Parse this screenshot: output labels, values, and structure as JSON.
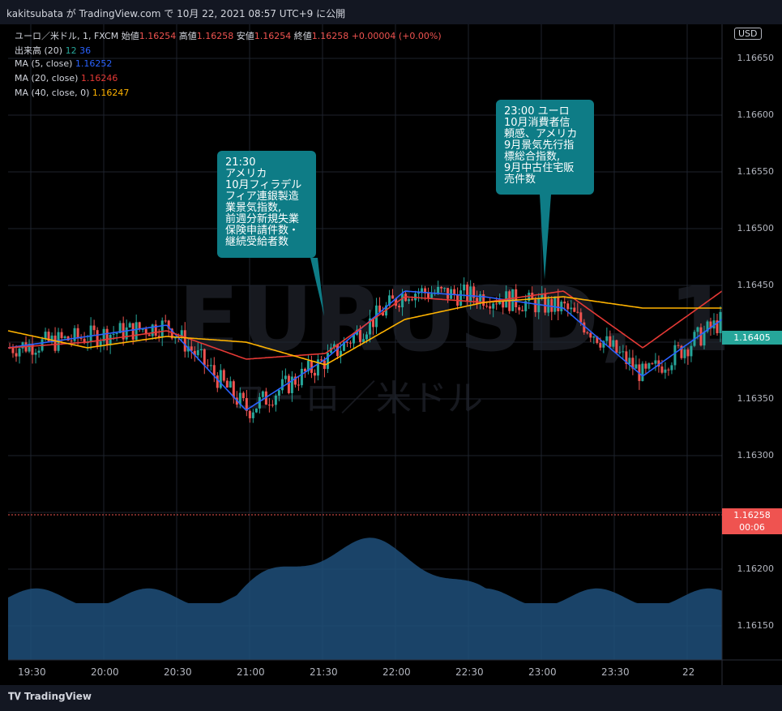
{
  "header": {
    "published_text": "kakitsubata が TradingView.com で 10月 22, 2021 08:57 UTC+9 に公開"
  },
  "legend": {
    "symbol": "ユーロ／米ドル, 1, FXCM",
    "open_label": "始値",
    "open": "1.16254",
    "high_label": "高値",
    "high": "1.16258",
    "low_label": "安値",
    "low": "1.16254",
    "close_label": "終値",
    "close": "1.16258",
    "change": "+0.00004 (+0.00%)",
    "volume_label": "出来高 (20)",
    "volume_val1": "12",
    "volume_val2": "36",
    "ma5_label": "MA (5, close)",
    "ma5_val": "1.16252",
    "ma20_label": "MA (20, close)",
    "ma20_val": "1.16246",
    "ma40_label": "MA (40, close, 0)",
    "ma40_val": "1.16247"
  },
  "watermark": {
    "ticker": "EURUSD, 1",
    "name": "ユーロ／米ドル"
  },
  "currency": "USD",
  "price_axis_labels": [
    "1.16650",
    "1.16600",
    "1.16550",
    "1.16500",
    "1.16450",
    "1.16400",
    "1.16350",
    "1.16300",
    "1.16250",
    "1.16200",
    "1.16150"
  ],
  "time_axis_labels": [
    "19:30",
    "20:00",
    "20:30",
    "21:00",
    "21:30",
    "22:00",
    "22:30",
    "23:00",
    "23:30",
    "22"
  ],
  "current_price_tag": "1.16405",
  "last_close_tag": "1.16258",
  "countdown": "00:06",
  "annotations": [
    {
      "text": "21:30\nアメリカ\n10月フィラデル\nフィア連銀製造\n業景気指数,\n前週分新規失業\n保険申請件数・\n継続受給者数"
    },
    {
      "text": "23:00 ユーロ\n10月消費者信\n頼感、アメリカ\n9月景気先行指\n標総合指数,\n9月中古住宅販\n売件数"
    }
  ],
  "footer": {
    "brand": "TradingView"
  },
  "colors": {
    "up": "#26a69a",
    "down": "#ef5350",
    "ma5": "#2962ff",
    "ma20": "#e53935",
    "ma40": "#ffb300",
    "volume": "#1e4f7a",
    "note": "#0e7c86"
  },
  "chart_data": {
    "type": "line",
    "title": "ユーロ／米ドル, 1, FXCM",
    "ylim": [
      1.1612,
      1.1668
    ],
    "x": [
      "19:30",
      "20:00",
      "20:30",
      "21:00",
      "21:30",
      "22:00",
      "22:30",
      "23:00",
      "23:30",
      "00:00"
    ],
    "series": [
      {
        "name": "MA (5, close)",
        "values": [
          1.16395,
          1.16405,
          1.16415,
          1.1634,
          1.16385,
          1.16445,
          1.1644,
          1.1643,
          1.1637,
          1.1642
        ]
      },
      {
        "name": "MA (20, close)",
        "values": [
          1.16395,
          1.164,
          1.1641,
          1.16385,
          1.1639,
          1.1644,
          1.16435,
          1.16445,
          1.16395,
          1.16445
        ]
      },
      {
        "name": "MA (40, close, 0)",
        "values": [
          1.1641,
          1.16395,
          1.16405,
          1.164,
          1.1638,
          1.1642,
          1.16435,
          1.1644,
          1.1643,
          1.1643
        ]
      }
    ]
  }
}
